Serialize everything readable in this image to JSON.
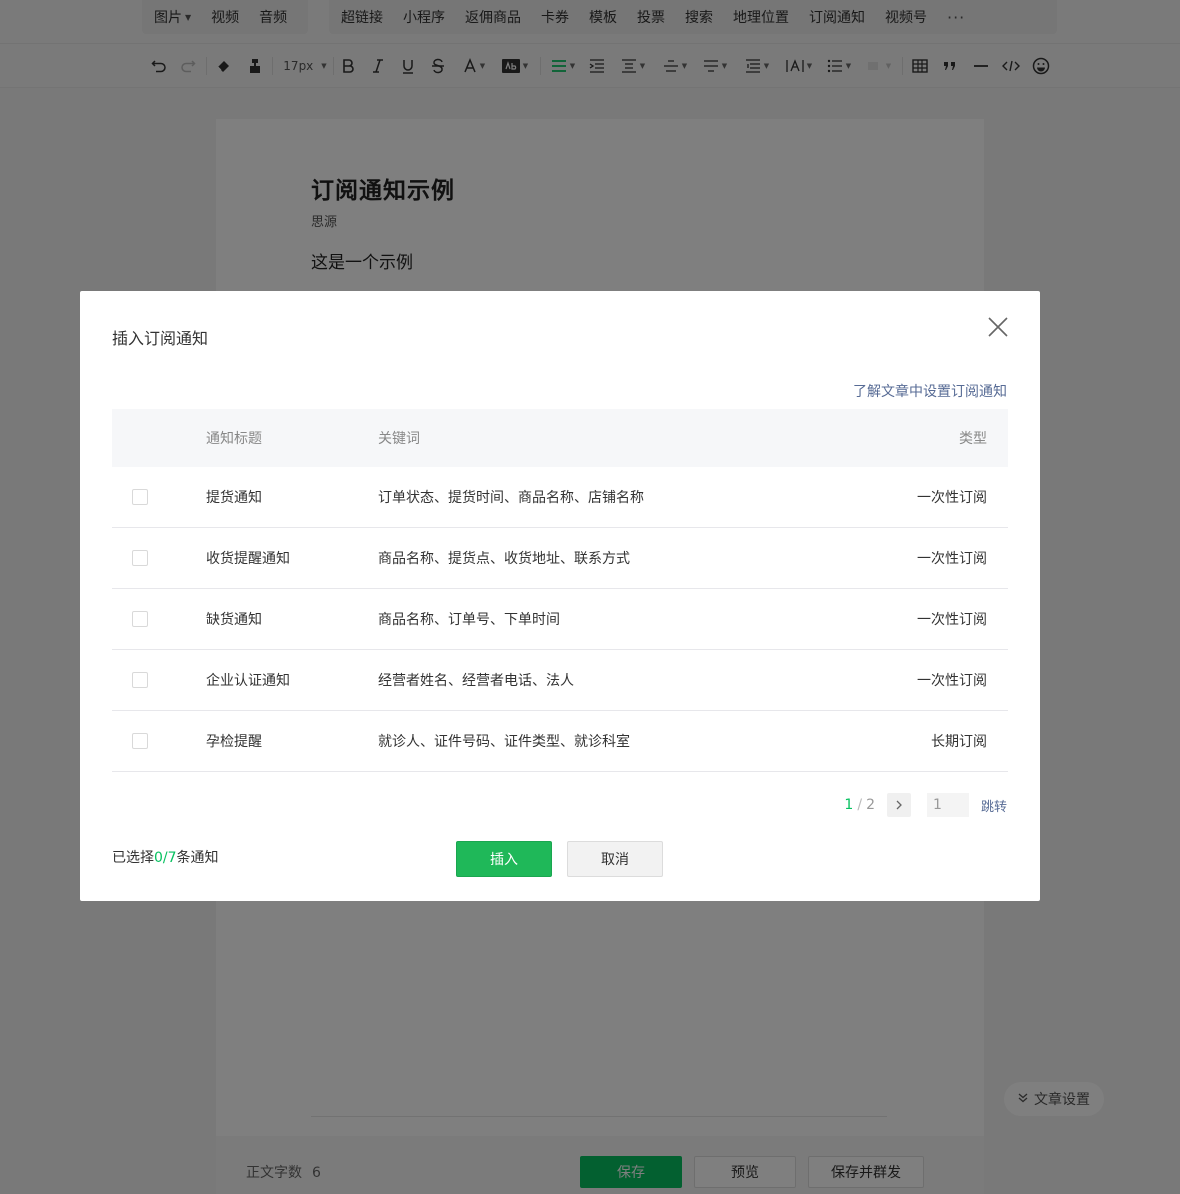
{
  "menu": {
    "group1": [
      {
        "label": "图片",
        "dropdown": true
      },
      {
        "label": "视频",
        "dropdown": false
      },
      {
        "label": "音频",
        "dropdown": false
      }
    ],
    "group2": [
      "超链接",
      "小程序",
      "返佣商品",
      "卡券",
      "模板",
      "投票",
      "搜索",
      "地理位置",
      "订阅通知",
      "视频号"
    ],
    "more": "···"
  },
  "toolbar": {
    "font_size": "17px"
  },
  "article": {
    "title": "订阅通知示例",
    "author": "思源",
    "body": "这是一个示例"
  },
  "article_settings": {
    "label": "文章设置"
  },
  "footer": {
    "wordcount_label": "正文字数",
    "wordcount_value": "6",
    "save": "保存",
    "preview": "预览",
    "publish": "保存并群发"
  },
  "dialog": {
    "title": "插入订阅通知",
    "help_link": "了解文章中设置订阅通知",
    "columns": {
      "title": "通知标题",
      "keywords": "关键词",
      "type": "类型"
    },
    "rows": [
      {
        "title": "提货通知",
        "keywords": "订单状态、提货时间、商品名称、店铺名称",
        "type": "一次性订阅",
        "checked": false
      },
      {
        "title": "收货提醒通知",
        "keywords": "商品名称、提货点、收货地址、联系方式",
        "type": "一次性订阅",
        "checked": false
      },
      {
        "title": "缺货通知",
        "keywords": "商品名称、订单号、下单时间",
        "type": "一次性订阅",
        "checked": false
      },
      {
        "title": "企业认证通知",
        "keywords": "经营者姓名、经营者电话、法人",
        "type": "一次性订阅",
        "checked": false
      },
      {
        "title": "孕检提醒",
        "keywords": "就诊人、证件号码、证件类型、就诊科室",
        "type": "长期订阅",
        "checked": false
      }
    ],
    "pagination": {
      "current": "1",
      "slash": "/",
      "total": "2",
      "input_value": "1",
      "jump": "跳转"
    },
    "selection": {
      "prefix": "已选择",
      "count": "0/7",
      "suffix": "条通知"
    },
    "insert_button": "插入",
    "cancel_button": "取消"
  }
}
